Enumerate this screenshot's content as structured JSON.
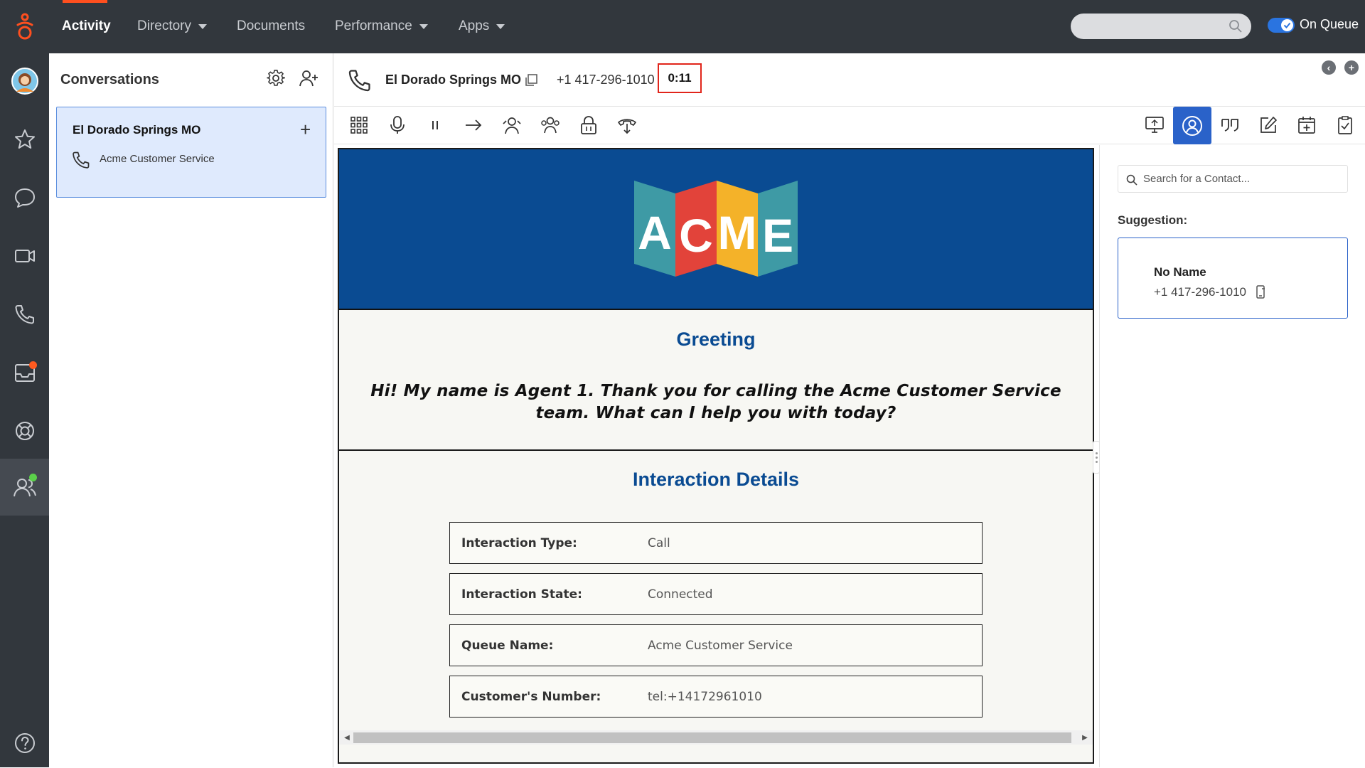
{
  "topnav": {
    "items": [
      "Activity",
      "Directory",
      "Documents",
      "Performance",
      "Apps"
    ],
    "search_placeholder": "",
    "on_queue_label": "On Queue"
  },
  "rail": {
    "icons": [
      "avatar",
      "favorites-icon",
      "chat-icon",
      "video-icon",
      "phone-icon",
      "inbox-icon",
      "help-center-icon",
      "people-icon",
      "help-icon"
    ]
  },
  "conversations": {
    "title": "Conversations",
    "card": {
      "title": "El Dorado Springs MO",
      "queue": "Acme Customer Service"
    }
  },
  "interaction": {
    "name": "El Dorado Springs MO",
    "number": "+1 417-296-1010",
    "timer": "0:11"
  },
  "script": {
    "logo_letters": [
      "A",
      "C",
      "M",
      "E"
    ],
    "greeting_title": "Greeting",
    "greeting_text": "Hi! My name is Agent 1. Thank you for calling the Acme Customer Service team. What can I help you with today?",
    "details_title": "Interaction Details",
    "details": [
      {
        "label": "Interaction Type:",
        "value": "Call"
      },
      {
        "label": "Interaction State:",
        "value": "Connected"
      },
      {
        "label": "Queue Name:",
        "value": "Acme Customer Service"
      },
      {
        "label": "Customer's Number:",
        "value": "tel:+14172961010"
      }
    ]
  },
  "contact_panel": {
    "search_placeholder": "Search for a Contact...",
    "suggestion_label": "Suggestion:",
    "suggestion_name": "No Name",
    "suggestion_number": "+1 417-296-1010"
  },
  "colors": {
    "topbar": "#32373d",
    "accent": "#ff4f1f",
    "brand_blue": "#0a4b92",
    "selection_blue": "#2a62c9",
    "timer_border": "#e1251b"
  }
}
